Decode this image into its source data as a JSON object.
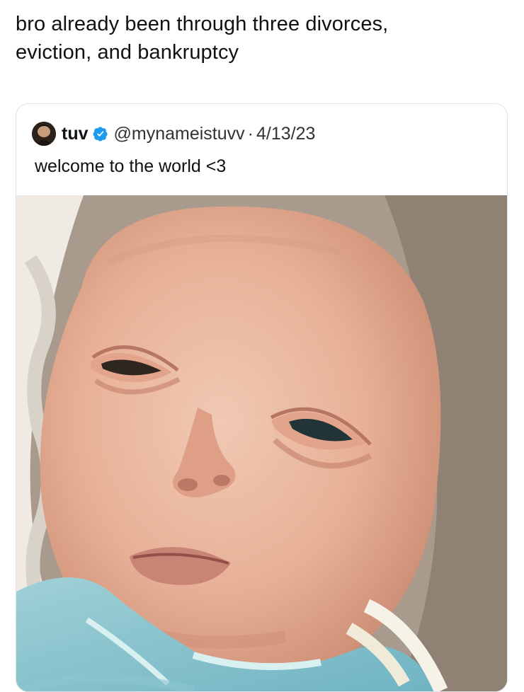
{
  "caption": {
    "line1": "bro already been through three divorces,",
    "line2": "eviction, and bankruptcy"
  },
  "quoted_tweet": {
    "author_name": "tuv",
    "handle": "@mynameistuvv",
    "separator": "·",
    "date": "4/13/23",
    "text": "welcome to the world <3",
    "verified": true,
    "avatar_icon": "profile-avatar",
    "verified_icon": "verified-badge-icon",
    "verified_color": "#1d9bf0"
  }
}
